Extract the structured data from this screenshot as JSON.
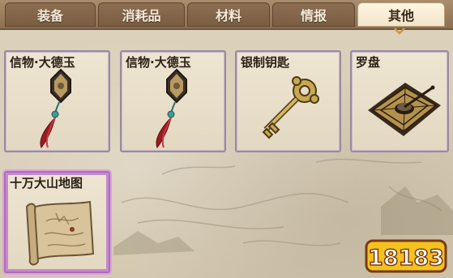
{
  "tabs": [
    {
      "label": "装备",
      "active": false
    },
    {
      "label": "消耗品",
      "active": false
    },
    {
      "label": "材料",
      "active": false
    },
    {
      "label": "情报",
      "active": false
    },
    {
      "label": "其他",
      "active": true
    }
  ],
  "items": [
    {
      "name": "信物·大德玉",
      "icon": "jade-pendant-icon"
    },
    {
      "name": "信物·大德玉",
      "icon": "jade-pendant-icon"
    },
    {
      "name": "银制钥匙",
      "icon": "key-icon"
    },
    {
      "name": "罗盘",
      "icon": "compass-icon"
    },
    {
      "name": "十万大山地图",
      "icon": "map-scroll-icon",
      "selected": true
    }
  ],
  "watermark": {
    "text": "18183"
  }
}
